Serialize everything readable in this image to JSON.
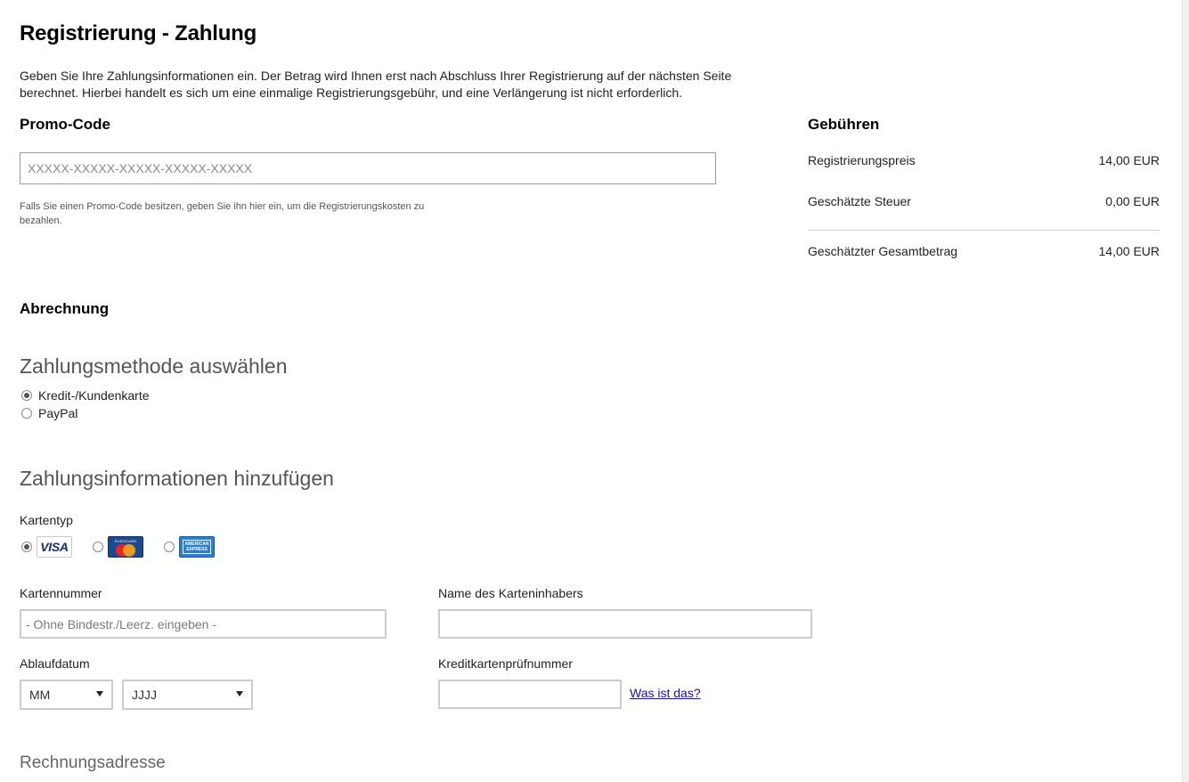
{
  "page": {
    "title": "Registrierung - Zahlung",
    "intro": "Geben Sie Ihre Zahlungsinformationen ein. Der Betrag wird Ihnen erst nach Abschluss Ihrer Registrierung auf der nächsten Seite berechnet. Hierbei handelt es sich um eine einmalige Registrierungsgebühr, und eine Verlängerung ist nicht erforderlich."
  },
  "promo": {
    "title": "Promo-Code",
    "placeholder": "XXXXX-XXXXX-XXXXX-XXXXX-XXXXX",
    "value": "",
    "help": "Falls Sie einen Promo-Code besitzen, geben Sie ihn hier ein, um die Registrierungskosten zu bezahlen."
  },
  "fees": {
    "title": "Gebühren",
    "rows": [
      {
        "label": "Registrierungspreis",
        "value": "14,00 EUR"
      },
      {
        "label": "Geschätzte Steuer",
        "value": "0,00 EUR"
      },
      {
        "label": "Geschätzter Gesamtbetrag",
        "value": "14,00 EUR"
      }
    ]
  },
  "billing": {
    "title": "Abrechnung",
    "method_heading": "Zahlungsmethode auswählen",
    "methods": [
      {
        "label": "Kredit-/Kundenkarte",
        "selected": true
      },
      {
        "label": "PayPal",
        "selected": false
      }
    ],
    "info_heading": "Zahlungsinformationen hinzufügen",
    "card_type_label": "Kartentyp",
    "card_types": [
      {
        "name": "visa-logo",
        "text": "VISA",
        "selected": true
      },
      {
        "name": "mastercard-logo",
        "top_text": "EUROCARD",
        "text": "MasterCard",
        "selected": false
      },
      {
        "name": "amex-logo",
        "text_line1": "AMERICAN",
        "text_line2": "EXPRESS",
        "selected": false
      }
    ],
    "card_number_label": "Kartennummer",
    "card_number_placeholder": "- Ohne Bindestr./Leerz. eingeben -",
    "card_holder_label": "Name des Karteninhabers",
    "card_holder_value": "",
    "expiry_label": "Ablaufdatum",
    "expiry_month": "MM",
    "expiry_year": "JJJJ",
    "cvv_label": "Kreditkartenprüfnummer",
    "cvv_value": "",
    "cvv_help_link": "Was ist das?",
    "address_heading": "Rechnungsadresse"
  }
}
